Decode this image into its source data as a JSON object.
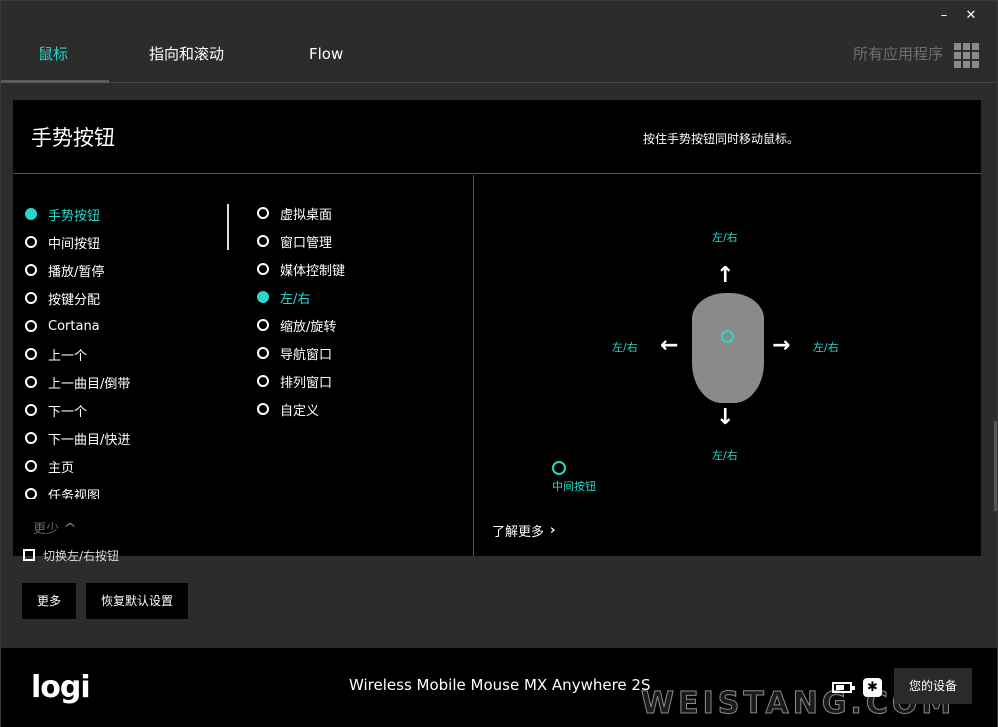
{
  "window": {
    "minimize_label": "–",
    "close_label": "✕"
  },
  "tabs": [
    {
      "label": "鼠标"
    },
    {
      "label": "指向和滚动"
    },
    {
      "label": "Flow"
    }
  ],
  "all_apps_label": "所有应用程序",
  "panel": {
    "title": "手势按钮",
    "hint": "按住手势按钮同时移动鼠标。"
  },
  "button_options": [
    {
      "label": "手势按钮",
      "selected": true
    },
    {
      "label": "中间按钮",
      "selected": false
    },
    {
      "label": "播放/暂停",
      "selected": false
    },
    {
      "label": "按键分配",
      "selected": false
    },
    {
      "label": "Cortana",
      "selected": false
    },
    {
      "label": "上一个",
      "selected": false
    },
    {
      "label": "上一曲目/倒带",
      "selected": false
    },
    {
      "label": "下一个",
      "selected": false
    },
    {
      "label": "下一曲目/快进",
      "selected": false
    },
    {
      "label": "主页",
      "selected": false
    },
    {
      "label": "任务视图",
      "selected": false
    }
  ],
  "gesture_options": [
    {
      "label": "虚拟桌面",
      "selected": false
    },
    {
      "label": "窗口管理",
      "selected": false
    },
    {
      "label": "媒体控制键",
      "selected": false
    },
    {
      "label": "左/右",
      "selected": true
    },
    {
      "label": "缩放/旋转",
      "selected": false
    },
    {
      "label": "导航窗口",
      "selected": false
    },
    {
      "label": "排列窗口",
      "selected": false
    },
    {
      "label": "自定义",
      "selected": false
    }
  ],
  "less_label": "更少",
  "diagram": {
    "up_label": "左/右",
    "left_label": "左/右",
    "right_label": "左/右",
    "down_label": "左/右",
    "middle_button_label": "中间按钮",
    "learn_more_label": "了解更多"
  },
  "swap_label": "切换左/右按钮",
  "buttons": {
    "more_label": "更多",
    "restore_label": "恢复默认设置"
  },
  "footer": {
    "logo": "logi",
    "device_name": "Wireless Mobile Mouse MX Anywhere 2S",
    "your_devices_label": "您的设备",
    "bluetooth_icon": "✱",
    "watermark": "WEISTANG.COM"
  },
  "colors": {
    "accent": "#29d6c9",
    "background": "#2c2c2c",
    "panel": "#000000"
  }
}
